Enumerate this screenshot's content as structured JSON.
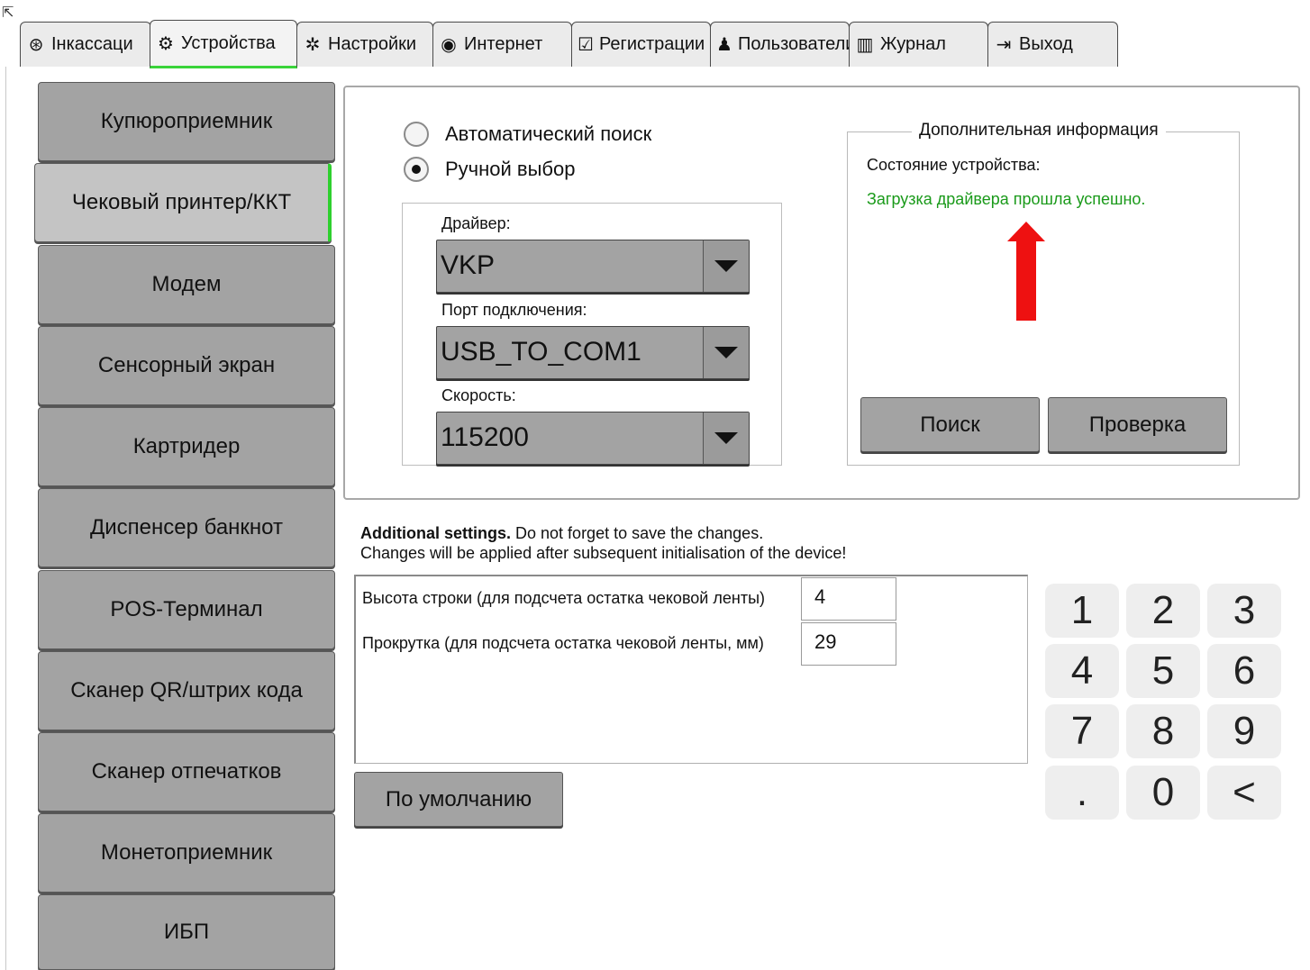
{
  "tabs": [
    {
      "label": "Інкассаци",
      "icon": "dollar-circle-icon"
    },
    {
      "label": "Устройства",
      "icon": "gears-icon"
    },
    {
      "label": "Настройки",
      "icon": "gear-icon"
    },
    {
      "label": "Интернет",
      "icon": "antenna-icon"
    },
    {
      "label": "Регистрации",
      "icon": "clipboard-check-icon"
    },
    {
      "label": "Пользователи",
      "icon": "users-icon"
    },
    {
      "label": "Журнал",
      "icon": "books-icon"
    },
    {
      "label": "Выход",
      "icon": "exit-icon"
    }
  ],
  "devices": [
    "Купюроприемник",
    "Чековый принтер/ККТ",
    "Модем",
    "Сенсорный экран",
    "Картридер",
    "Диспенсер банкнот",
    "POS-Терминал",
    "Сканер QR/штрих кода",
    "Сканер отпечатков",
    "Монетоприемник",
    "ИБП"
  ],
  "search_mode": {
    "auto_label": "Автоматический поиск",
    "manual_label": "Ручной выбор",
    "selected": "manual"
  },
  "driver": {
    "label": "Драйвер:",
    "value": "VKP"
  },
  "port": {
    "label": "Порт подключения:",
    "value": "USB_TO_COM1"
  },
  "speed": {
    "label": "Скорость:",
    "value": "115200"
  },
  "info": {
    "legend": "Дополнительная информация",
    "state_label": "Состояние устройства:",
    "state_message": "Загрузка драйвера прошла успешно.",
    "state_color": "#1a9a1a",
    "search_button": "Поиск",
    "check_button": "Проверка"
  },
  "additional": {
    "title": "Additional settings.",
    "note": " Do not forget to save the changes.",
    "line2": "Changes will be applied after subsequent initialisation of the device!"
  },
  "settings": [
    {
      "label": "Высота строки (для подсчета остатка чековой ленты)",
      "value": "4"
    },
    {
      "label": "Прокрутка (для подсчета остатка чековой ленты, мм)",
      "value": "29"
    }
  ],
  "default_button": "По умолчанию",
  "keypad": [
    "1",
    "2",
    "3",
    "4",
    "5",
    "6",
    "7",
    "8",
    "9",
    ".",
    "0",
    "<"
  ]
}
